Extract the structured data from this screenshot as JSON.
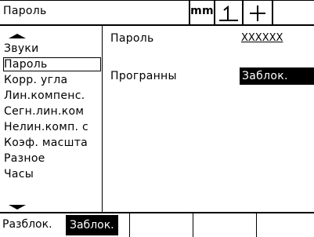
{
  "header": {
    "title": "Пароль",
    "unit": "mm",
    "datum_icon": "datum-one-icon",
    "cross_icon": "crosshair-icon"
  },
  "menu": {
    "scroll_up_icon": "scroll-up-arrow-icon",
    "scroll_down_icon": "scroll-down-arrow-icon",
    "items": [
      "Звуки",
      "Пароль",
      "Корр. угла",
      "Лин.компенс.",
      "Сегн.лин.ком",
      "Нелин.комп. с",
      "Коэф. масшта",
      "Разное",
      "Часы"
    ]
  },
  "form": {
    "password_label": "Пароль",
    "password_value": "XXXXXX",
    "programs_label": "Програнны",
    "programs_value": "Заблок."
  },
  "softkeys": {
    "label": "Разблок.",
    "value": "Заблок."
  }
}
